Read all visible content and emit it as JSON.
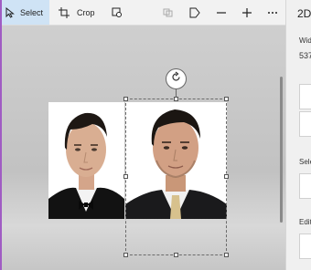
{
  "toolbar": {
    "select_label": "Select",
    "crop_label": "Crop",
    "icons": [
      "select-cursor-icon",
      "crop-icon",
      "magic-select-icon",
      "flip-icon",
      "sticker-icon",
      "minus-icon",
      "plus-icon",
      "more-icon"
    ]
  },
  "side_panel": {
    "header": "2D",
    "width_label": "Wid",
    "width_value": "537",
    "select_label": "Sele",
    "edit_label": "Edit"
  },
  "colors": {
    "window_frame": "#a05cc3",
    "active_tool_bg": "#cfe3f5",
    "canvas_bg": "#c7c7c7"
  },
  "canvas": {
    "image_1": "portrait of man in tuxedo with bow tie",
    "image_2": "portrait of man in suit with gold tie"
  }
}
